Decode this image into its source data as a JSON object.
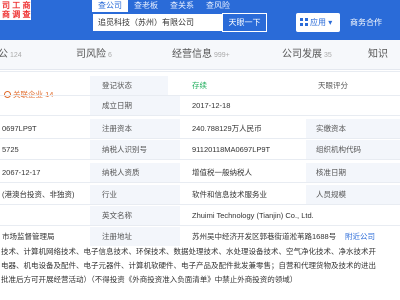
{
  "colors": {
    "brand": "#2a6bd8",
    "status_ok": "#1fae5c",
    "label_bg": "#f3f6fb"
  },
  "topbar": {
    "brand_line1": "司 工 商",
    "brand_line2": "商 调 查",
    "tabs": [
      "查公司",
      "查老板",
      "查关系",
      "查风险"
    ],
    "search_value": "追觅科技（苏州）有限公司",
    "search_button": "天眼一下",
    "apps_label": "应用",
    "apps_caret": "▾",
    "business_link": "商务合作"
  },
  "section_tabs": [
    {
      "label": "公",
      "count": "124"
    },
    {
      "label": "司风险",
      "count": "6"
    },
    {
      "label": "经营信息",
      "count": "999+"
    },
    {
      "label": "公司发展",
      "count": "35"
    },
    {
      "label": "知识",
      "count": ""
    }
  ],
  "left_panel": {
    "related_label": "关联企业",
    "related_count": "14",
    "frag_code": "0697LP9T",
    "frag_num": "5725",
    "frag_date": "2067-12-17",
    "frag_type": "(港澳台投资、非独资)",
    "frag_reg": "市场监督管理局"
  },
  "rows": [
    {
      "label": "登记状态",
      "value": "存续",
      "right_label": "天眼评分",
      "right_value": ""
    },
    {
      "label": "成立日期",
      "value": "2017-12-18",
      "right_label": "",
      "right_value": ""
    },
    {
      "label": "注册资本",
      "value": "240.788129万人民币",
      "right_label": "实缴资本",
      "right_value": ""
    },
    {
      "label": "纳税人识别号",
      "value": "91120118MA0697LP9T",
      "right_label": "组织机构代码",
      "right_value": ""
    },
    {
      "label": "纳税人资质",
      "value": "增值税一般纳税人",
      "right_label": "核准日期",
      "right_value": ""
    },
    {
      "label": "行业",
      "value": "软件和信息技术服务业",
      "right_label": "人员规模",
      "right_value": ""
    },
    {
      "label": "英文名称",
      "value": "Zhuimi Technology (Tianjin) Co., Ltd.",
      "right_label": "",
      "right_value": ""
    },
    {
      "label": "注册地址",
      "value": "苏州吴中经济开发区郭巷街道淞苇路1688号",
      "right_label": "附近公司",
      "right_value": ""
    }
  ],
  "scope_lines": [
    "技术、计算机网络技术、电子信息技术、环保技术、数据处理技术、水处理设备技术、空气净化技术、净水技术开",
    "电器、机电设备及配件、电子元器件、计算机软硬件、电子产品及配件批发兼零售；自营和代理货物及技术的进出",
    "批准后方可开展经营活动）（不得投资《外商投资准入负面清单》中禁止外商投资的领域）"
  ]
}
